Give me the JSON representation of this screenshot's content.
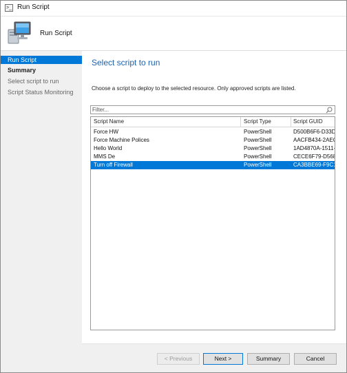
{
  "window": {
    "title": "Run Script",
    "icon": "console-window-icon"
  },
  "header": {
    "title": "Run Script",
    "icon": "computer-monitor-icon"
  },
  "nav": {
    "items": [
      {
        "label": "Run Script",
        "state": "active"
      },
      {
        "label": "Summary",
        "state": "bold"
      },
      {
        "label": "Select script to run",
        "state": "normal"
      },
      {
        "label": "Script Status Monitoring",
        "state": "normal"
      }
    ]
  },
  "content": {
    "page_title": "Select script to run",
    "instruction": "Choose a script to deploy to the selected resource. Only approved scripts are listed."
  },
  "filter": {
    "placeholder": "Filter...",
    "value": "",
    "icon": "search-icon"
  },
  "table": {
    "columns": [
      "Script Name",
      "Script Type",
      "Script GUID"
    ],
    "rows": [
      {
        "name": "Force HW",
        "type": "PowerShell",
        "guid": "D500B6F6-D33D-",
        "selected": false
      },
      {
        "name": "Force Machine Polices",
        "type": "PowerShell",
        "guid": "AACFB434-2AEC-",
        "selected": false
      },
      {
        "name": "Hello World",
        "type": "PowerShell",
        "guid": "1AD4870A-1511-4",
        "selected": false
      },
      {
        "name": "MMS De",
        "type": "PowerShell",
        "guid": "CECE6F79-D568-",
        "selected": false
      },
      {
        "name": "Turn off Firewall",
        "type": "PowerShell",
        "guid": "CA3BBE69-F9C1-",
        "selected": true
      }
    ]
  },
  "buttons": {
    "previous": "< Previous",
    "next": "Next >",
    "summary": "Summary",
    "cancel": "Cancel"
  },
  "colors": {
    "accent": "#0078d7",
    "title_blue": "#1f5fa8",
    "nav_bg": "#f0f0f0"
  }
}
